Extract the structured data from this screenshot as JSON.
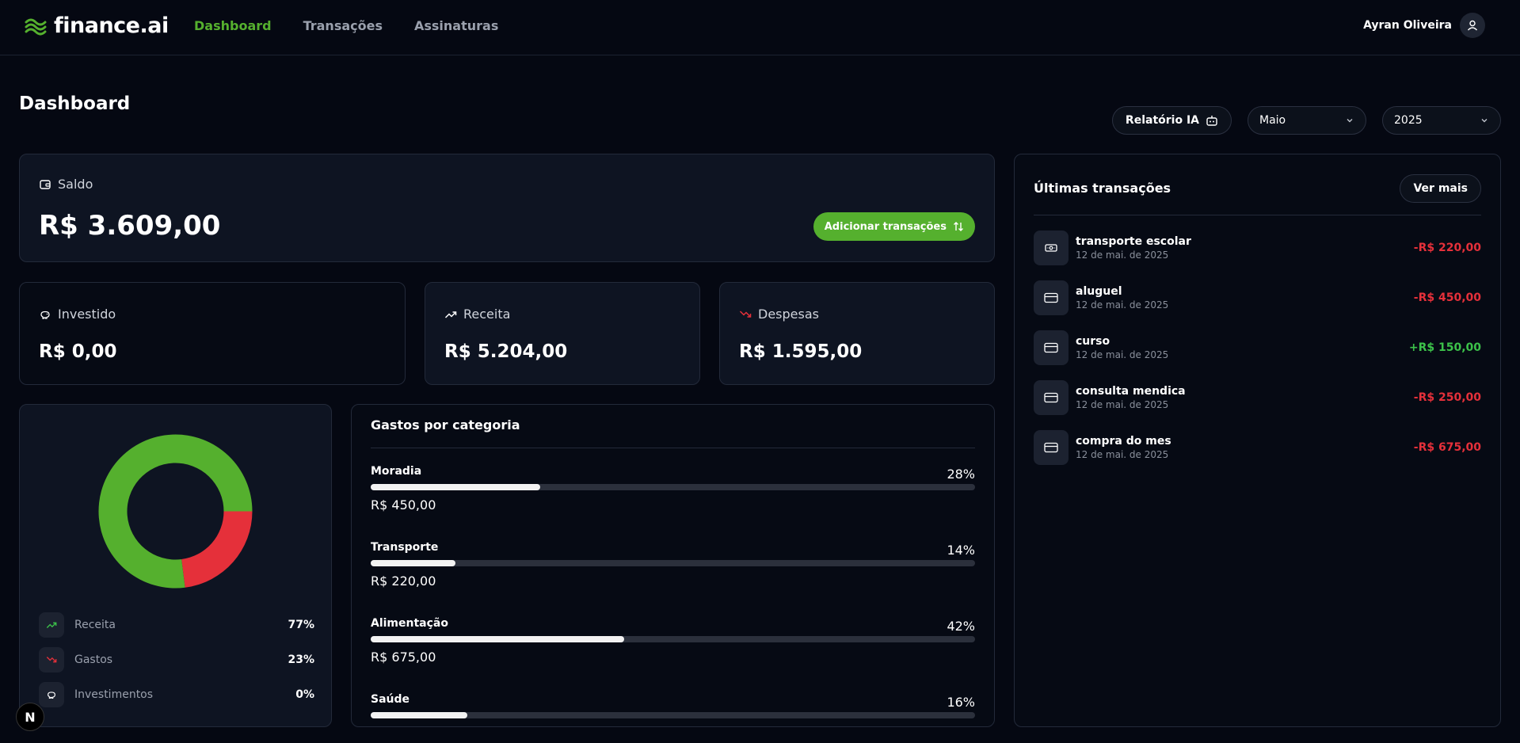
{
  "app": {
    "logo_text": "finance.ai",
    "nav": [
      {
        "label": "Dashboard",
        "active": true
      },
      {
        "label": "Transações",
        "active": false
      },
      {
        "label": "Assinaturas",
        "active": false
      }
    ],
    "user_name": "Ayran Oliveira"
  },
  "page": {
    "title": "Dashboard",
    "ai_report_label": "Relatório IA",
    "month": "Maio",
    "year": "2025"
  },
  "summary": {
    "balance_label": "Saldo",
    "balance_value": "R$ 3.609,00",
    "add_transaction_label": "Adicionar transações",
    "invested_label": "Investido",
    "invested_value": "R$ 0,00",
    "revenue_label": "Receita",
    "revenue_value": "R$ 5.204,00",
    "expenses_label": "Despesas",
    "expenses_value": "R$ 1.595,00"
  },
  "chart_data": {
    "type": "pie",
    "categories": [
      "Receita",
      "Gastos",
      "Investimentos"
    ],
    "values": [
      77,
      23,
      0
    ],
    "colors": [
      "#55b02e",
      "#e5303a",
      "#ffffff"
    ],
    "legend_pct": [
      "77%",
      "23%",
      "0%"
    ]
  },
  "categories": {
    "title": "Gastos por categoria",
    "items": [
      {
        "name": "Moradia",
        "pct_label": "28%",
        "pct": 28,
        "amount": "R$ 450,00"
      },
      {
        "name": "Transporte",
        "pct_label": "14%",
        "pct": 14,
        "amount": "R$ 220,00"
      },
      {
        "name": "Alimentação",
        "pct_label": "42%",
        "pct": 42,
        "amount": "R$ 675,00"
      },
      {
        "name": "Saúde",
        "pct_label": "16%",
        "pct": 16,
        "amount": ""
      }
    ]
  },
  "transactions": {
    "title": "Últimas transações",
    "more_label": "Ver mais",
    "items": [
      {
        "name": "transporte escolar",
        "date": "12 de mai. de 2025",
        "amount": "-R$ 220,00",
        "positive": false,
        "icon": "cash-icon"
      },
      {
        "name": "aluguel",
        "date": "12 de mai. de 2025",
        "amount": "-R$ 450,00",
        "positive": false,
        "icon": "credit-card-icon"
      },
      {
        "name": "curso",
        "date": "12 de mai. de 2025",
        "amount": "+R$ 150,00",
        "positive": true,
        "icon": "credit-card-icon"
      },
      {
        "name": "consulta mendica",
        "date": "12 de mai. de 2025",
        "amount": "-R$ 250,00",
        "positive": false,
        "icon": "credit-card-icon"
      },
      {
        "name": "compra do mes",
        "date": "12 de mai. de 2025",
        "amount": "-R$ 675,00",
        "positive": false,
        "icon": "credit-card-icon"
      }
    ]
  },
  "badge": "N"
}
